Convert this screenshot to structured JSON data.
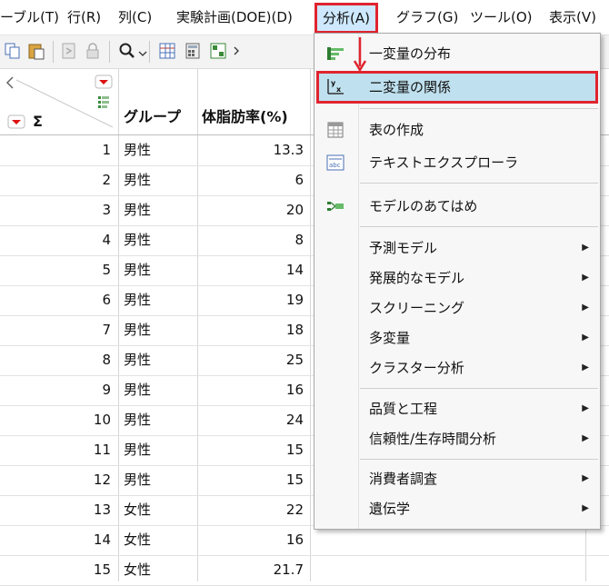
{
  "menubar": {
    "items": [
      {
        "label": "ーブル(T)"
      },
      {
        "label": "行(R)"
      },
      {
        "label": "列(C)"
      },
      {
        "label": "実験計画(DOE)(D)"
      },
      {
        "label": "分析(A)",
        "active": true
      },
      {
        "label": "グラフ(G)"
      },
      {
        "label": "ツール(O)"
      },
      {
        "label": "表示(V)"
      }
    ]
  },
  "toolbar": {
    "icons": [
      "copy-icon",
      "paste-icon",
      "script-icon",
      "lock-icon",
      "search-icon",
      "data-grid-icon",
      "calculator-icon",
      "layout-icon"
    ]
  },
  "table": {
    "columns": [
      "グループ",
      "体脂肪率(%)"
    ],
    "rows": [
      {
        "n": "1",
        "group": "男性",
        "value": "13.3"
      },
      {
        "n": "2",
        "group": "男性",
        "value": "6"
      },
      {
        "n": "3",
        "group": "男性",
        "value": "20"
      },
      {
        "n": "4",
        "group": "男性",
        "value": "8"
      },
      {
        "n": "5",
        "group": "男性",
        "value": "14"
      },
      {
        "n": "6",
        "group": "男性",
        "value": "19"
      },
      {
        "n": "7",
        "group": "男性",
        "value": "18"
      },
      {
        "n": "8",
        "group": "男性",
        "value": "25"
      },
      {
        "n": "9",
        "group": "男性",
        "value": "16"
      },
      {
        "n": "10",
        "group": "男性",
        "value": "24"
      },
      {
        "n": "11",
        "group": "男性",
        "value": "15"
      },
      {
        "n": "12",
        "group": "男性",
        "value": "15"
      },
      {
        "n": "13",
        "group": "女性",
        "value": "22"
      },
      {
        "n": "14",
        "group": "女性",
        "value": "16"
      },
      {
        "n": "15",
        "group": "女性",
        "value": "21.7"
      }
    ],
    "header_symbol": "Σ"
  },
  "menu": {
    "items": [
      {
        "label": "一変量の分布",
        "icon": "distribution-icon",
        "submenu": false
      },
      {
        "label": "二変量の関係",
        "icon": "fit-y-by-x-icon",
        "submenu": false,
        "highlighted": true
      },
      {
        "label": "表の作成",
        "icon": "tabulate-icon",
        "submenu": false
      },
      {
        "label": "テキストエクスプローラ",
        "icon": "text-explorer-icon",
        "submenu": false
      },
      {
        "label": "モデルのあてはめ",
        "icon": "fit-model-icon",
        "submenu": false
      },
      {
        "label": "予測モデル",
        "icon": "",
        "submenu": true
      },
      {
        "label": "発展的なモデル",
        "icon": "",
        "submenu": true
      },
      {
        "label": "スクリーニング",
        "icon": "",
        "submenu": true
      },
      {
        "label": "多変量",
        "icon": "",
        "submenu": true
      },
      {
        "label": "クラスター分析",
        "icon": "",
        "submenu": true
      },
      {
        "label": "品質と工程",
        "icon": "",
        "submenu": true
      },
      {
        "label": "信頼性/生存時間分析",
        "icon": "",
        "submenu": true
      },
      {
        "label": "消費者調査",
        "icon": "",
        "submenu": true
      },
      {
        "label": "遺伝学",
        "icon": "",
        "submenu": true
      }
    ],
    "arrow_glyph": "▶"
  },
  "colors": {
    "highlight_border": "#e0242f",
    "highlight_fill": "#bfe0ee",
    "active_menu_fill": "#cde8ff"
  }
}
